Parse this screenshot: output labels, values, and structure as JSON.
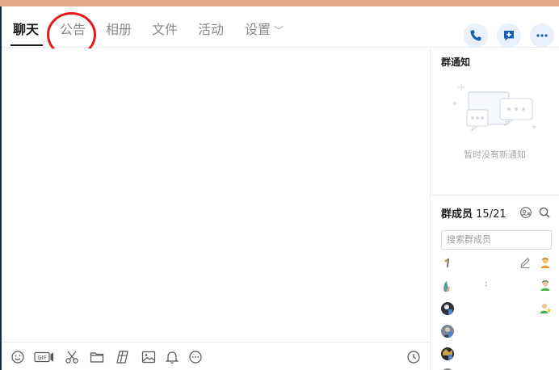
{
  "tabs": {
    "chat": "聊天",
    "notice": "公告",
    "album": "相册",
    "files": "文件",
    "activity": "活动",
    "settings": "设置"
  },
  "actions": {
    "call": "phone-icon",
    "add_message": "add-message-icon",
    "more": "more-icon"
  },
  "notice_panel": {
    "title": "群通知",
    "empty_text": "暂时没有新通知"
  },
  "members_panel": {
    "title": "群成员",
    "count": "15/21",
    "search_placeholder": "搜索群成员",
    "rows": [
      {
        "name": "",
        "role": "owner"
      },
      {
        "name": ":",
        "role": "admin"
      },
      {
        "name": "",
        "role": "star-admin"
      },
      {
        "name": "",
        "role": "member"
      },
      {
        "name": "",
        "role": "member"
      }
    ]
  },
  "toolbar": {
    "icons": [
      "emoji-icon",
      "gif-icon",
      "scissors-icon",
      "folder-icon",
      "sticker-icon",
      "image-icon",
      "bell-icon",
      "more-circle-icon",
      "history-clock-icon"
    ]
  },
  "colors": {
    "accent_blue": "#1a6fd6",
    "highlight_red": "#e21b1b",
    "top_strip": "#e4a98a"
  }
}
